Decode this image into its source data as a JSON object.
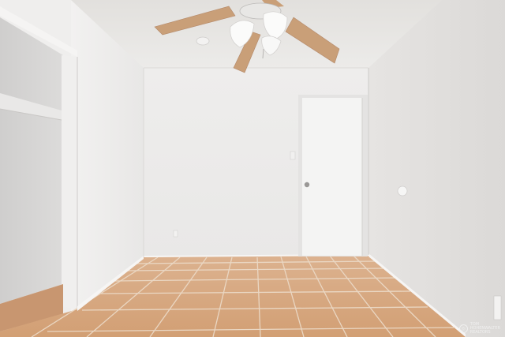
{
  "photo": {
    "subject": "empty bedroom",
    "colors": {
      "ceiling": "#e8e6e3",
      "wall_back": "#ecebea",
      "wall_right": "#e3e1df",
      "wall_left": "#efeeed",
      "closet_inner": "#d4d3d2",
      "floor_tile": "#d6a57c",
      "grout": "#ecdbc9",
      "door": "#f4f4f3",
      "fan_blade": "#caa07a"
    }
  },
  "watermark": {
    "line1": "Tom",
    "line2": "Hohenwalter",
    "line3": "REALTORS"
  }
}
